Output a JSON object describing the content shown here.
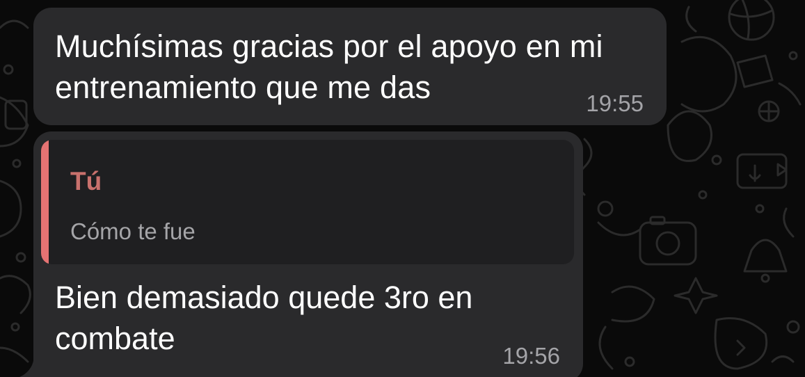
{
  "messages": [
    {
      "text": "Muchísimas gracias por el apoyo en mi entrenamiento que me das",
      "time": "19:55"
    },
    {
      "reply": {
        "author": "Tú",
        "text": "Cómo te fue",
        "accent_color": "#e57373"
      },
      "text": "Bien demasiado quede 3ro en combate",
      "time": "19:56"
    }
  ],
  "colors": {
    "bubble": "#2a2a2c",
    "background": "#0a0a0a",
    "quote_author": "#c9716d"
  }
}
